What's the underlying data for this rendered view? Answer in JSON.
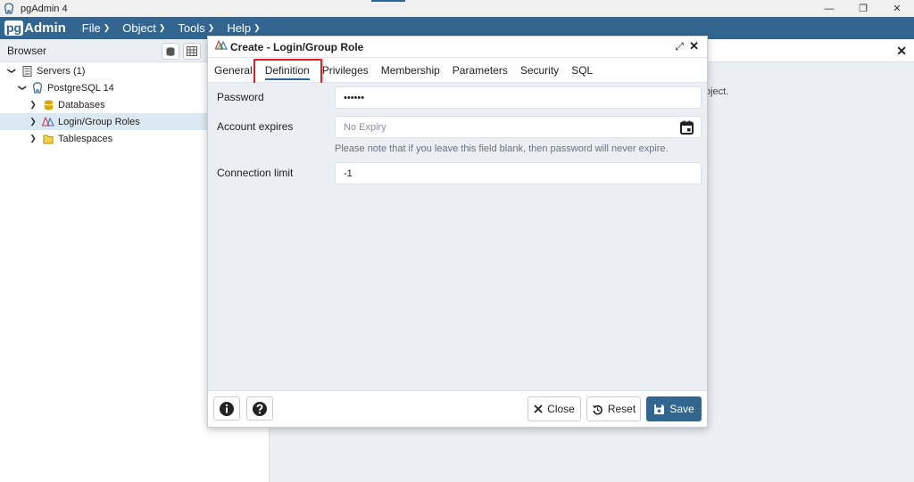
{
  "window": {
    "title": "pgAdmin 4",
    "minimize_glyph": "—",
    "restore_glyph": "❐",
    "close_glyph": "✕"
  },
  "menubar": {
    "logo_pg": "pg",
    "logo_admin": "Admin",
    "items": [
      "File",
      "Object",
      "Tools",
      "Help"
    ]
  },
  "browser": {
    "title": "Browser",
    "tree": [
      {
        "label": "Servers (1)",
        "toggle": "❯"
      },
      {
        "label": "PostgreSQL 14",
        "toggle": "❯"
      },
      {
        "label": "Databases",
        "toggle": "❯"
      },
      {
        "label": "Login/Group Roles",
        "toggle": "❯"
      },
      {
        "label": "Tablespaces",
        "toggle": "❯"
      }
    ]
  },
  "right_panel": {
    "partial_text": "bject.",
    "close_glyph": "✕"
  },
  "dialog": {
    "title": "Create - Login/Group Role",
    "tabs": [
      "General",
      "Definition",
      "Privileges",
      "Membership",
      "Parameters",
      "Security",
      "SQL"
    ],
    "active_tab": "Definition",
    "fields": {
      "password_label": "Password",
      "password_value": "••••••",
      "expires_label": "Account expires",
      "expires_placeholder": "No Expiry",
      "expires_note": "Please note that if you leave this field blank, then password will never expire.",
      "conn_limit_label": "Connection limit",
      "conn_limit_value": "-1"
    },
    "footer": {
      "close_label": "Close",
      "reset_label": "Reset",
      "save_label": "Save"
    }
  },
  "colors": {
    "brand": "#326690",
    "highlight": "#e02020"
  }
}
